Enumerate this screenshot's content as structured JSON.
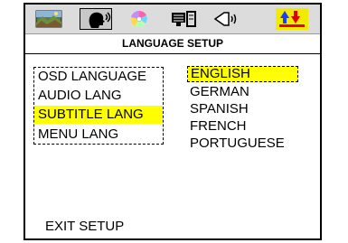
{
  "toolbar": {
    "icons": [
      "landscape-picture-icon",
      "speaking-head-icon",
      "color-disc-icon",
      "speaker-grille-icon",
      "speaker-sound-icon",
      "arrows-flag-icon"
    ],
    "selected_index": 1
  },
  "header": {
    "title": "LANGUAGE SETUP"
  },
  "menu": {
    "items": [
      {
        "label": "OSD LANGUAGE"
      },
      {
        "label": "AUDIO LANG"
      },
      {
        "label": "SUBTITLE LANG"
      },
      {
        "label": "MENU LANG"
      }
    ],
    "active_index": 2
  },
  "options": {
    "items": [
      {
        "label": "ENGLISH"
      },
      {
        "label": "GERMAN"
      },
      {
        "label": "SPANISH"
      },
      {
        "label": "FRENCH"
      },
      {
        "label": "PORTUGUESE"
      }
    ],
    "active_index": 0
  },
  "footer": {
    "exit_label": "EXIT SETUP"
  },
  "colors": {
    "highlight": "#ffff00",
    "toolbar_bg": "#dcdcdc"
  }
}
